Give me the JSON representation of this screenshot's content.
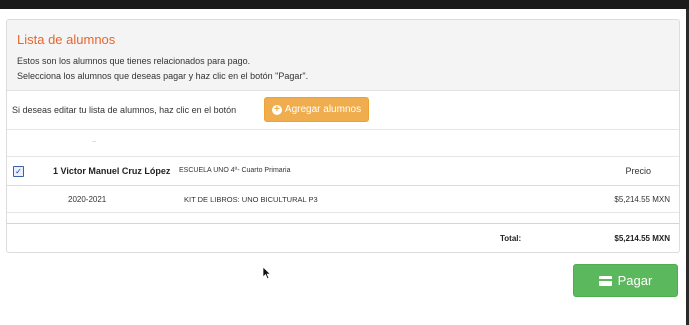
{
  "panel": {
    "title": "Lista de alumnos",
    "line1": "Estos son los alumnos que tienes relacionados para pago.",
    "line2": "Selecciona los alumnos que deseas pagar y haz clic en el botón \"Pagar\"."
  },
  "edit": {
    "text": "Si deseas editar tu lista de alumnos, haz clic en el botón",
    "add_button_label": "Agregar alumnos",
    "add_icon": "plus-circle-icon"
  },
  "table": {
    "price_header": "Precio",
    "student": {
      "checked": true,
      "name": "1 Victor Manuel Cruz López",
      "school": "ESCUELA UNO 4º- Cuarto Primaria"
    },
    "items": [
      {
        "year": "2020-2021",
        "description": "KIT DE LIBROS: UNO BICULTURAL P3",
        "price": "$5,214.55 MXN"
      }
    ],
    "total_label": "Total:",
    "total_value": "$5,214.55 MXN"
  },
  "pay": {
    "label": "Pagar",
    "icon": "credit-card-icon"
  },
  "colors": {
    "title": "#e8652c",
    "add_button": "#f0ad4e",
    "pay_button": "#5cb85c"
  }
}
